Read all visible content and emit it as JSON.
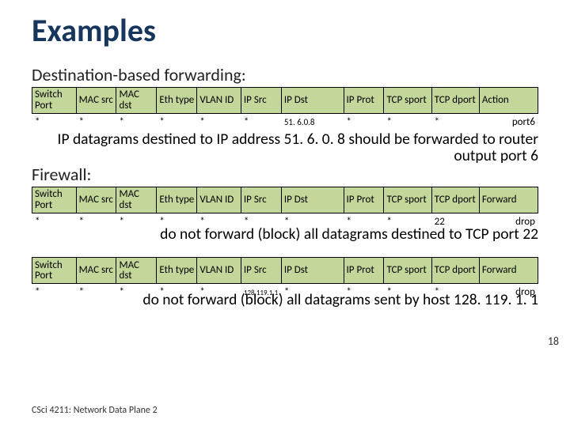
{
  "title": "Examples",
  "footer": {
    "left": "CSci 4211:          Network Data Plane 2",
    "pageNumber": "18"
  },
  "sections": {
    "dest": {
      "label": "Destination-based forwarding:",
      "headers": [
        "Switch Port",
        "MAC src",
        "MAC dst",
        "Eth type",
        "VLAN ID",
        "IP Src",
        "IP Dst",
        "IP Prot",
        "TCP sport",
        "TCP dport",
        "Action"
      ],
      "row": [
        "*",
        "*",
        "*",
        "*",
        "*",
        "*",
        "51. 6.0.8",
        "*",
        "*",
        "*",
        "port6"
      ],
      "explain": "IP datagrams destined to IP address 51. 6. 0. 8 should be forwarded to router output port 6"
    },
    "firewall": {
      "label": "Firewall:",
      "t1_headers": [
        "Switch Port",
        "MAC src",
        "MAC dst",
        "Eth type",
        "VLAN ID",
        "IP Src",
        "IP Dst",
        "IP Prot",
        "TCP sport",
        "TCP dport",
        "Forward"
      ],
      "t1_row": [
        "*",
        "*",
        "*",
        "*",
        "*",
        "*",
        "*",
        "*",
        "*",
        "22",
        "drop"
      ],
      "t1_explain": "do not forward (block) all datagrams destined to TCP port 22",
      "t2_headers": [
        "Switch Port",
        "MAC src",
        "MAC dst",
        "Eth type",
        "VLAN ID",
        "IP Src",
        "IP Dst",
        "IP Prot",
        "TCP sport",
        "TCP dport",
        "Forward"
      ],
      "t2_row": [
        "*",
        "*",
        "*",
        "*",
        "*",
        "128.119.1.1",
        "*",
        "*",
        "*",
        "*",
        "drop"
      ],
      "t2_explain": "do not forward (block) all datagrams sent by host 128. 119. 1. 1"
    }
  }
}
